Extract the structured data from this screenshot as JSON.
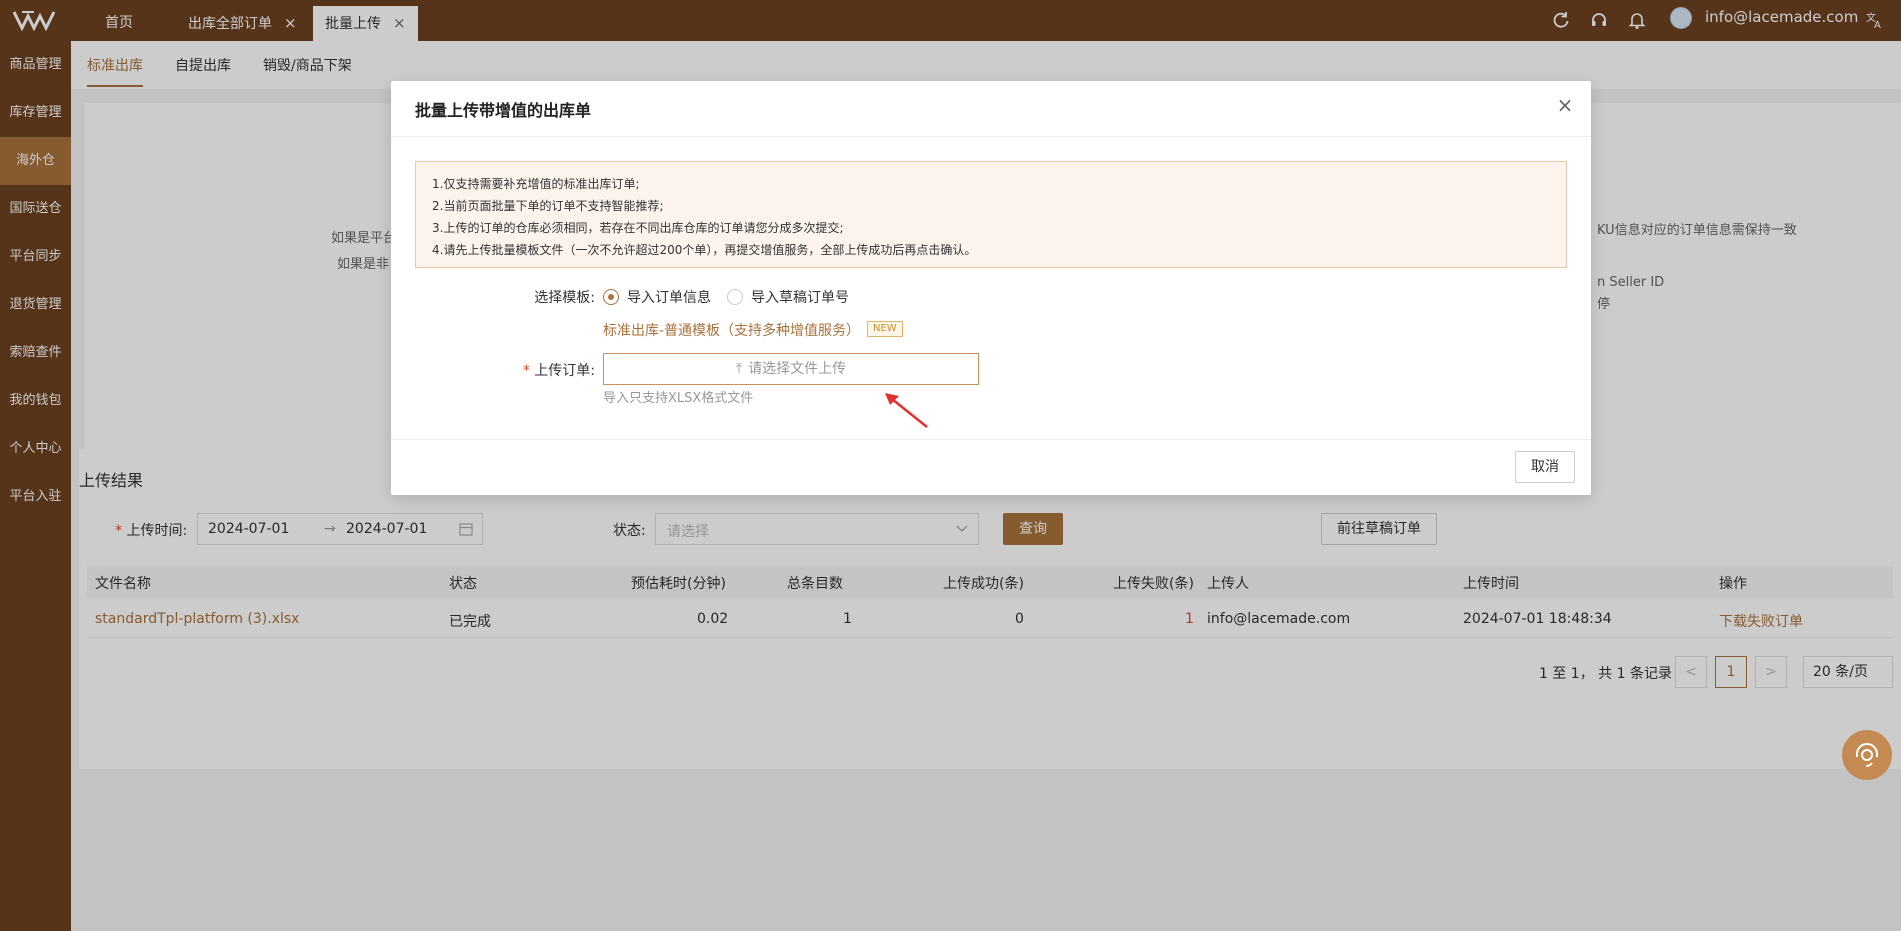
{
  "topbar": {
    "tabs": [
      {
        "label": "首页"
      },
      {
        "label": "出库全部订单"
      },
      {
        "label": "批量上传"
      }
    ],
    "user_email": "info@lacemade.com",
    "icons": [
      "refresh-icon",
      "headset-icon",
      "bell-icon",
      "translate-icon"
    ]
  },
  "sidebar": {
    "items": [
      {
        "label": "商品管理"
      },
      {
        "label": "库存管理"
      },
      {
        "label": "海外仓"
      },
      {
        "label": "国际送仓"
      },
      {
        "label": "平台同步"
      },
      {
        "label": "退货管理"
      },
      {
        "label": "索赔查件"
      },
      {
        "label": "我的钱包"
      },
      {
        "label": "个人中心"
      },
      {
        "label": "平台入驻"
      }
    ],
    "active_index": 2
  },
  "subtabs": [
    {
      "label": "标准出库"
    },
    {
      "label": "自提出库"
    },
    {
      "label": "销毁/商品下架"
    }
  ],
  "background_text": {
    "left1": "如果是平台",
    "left2": "如果是非",
    "right1": "KU信息对应的订单信息需保持一致",
    "right2": "n Seller ID",
    "right3": "停"
  },
  "upload_results": {
    "title": "上传结果",
    "time_label": "上传时间:",
    "date_start": "2024-07-01",
    "date_end": "2024-07-01",
    "status_label": "状态:",
    "status_placeholder": "请选择",
    "query_button": "查询",
    "draft_button": "前往草稿订单",
    "columns": [
      "文件名称",
      "状态",
      "预估耗时(分钟)",
      "总条目数",
      "上传成功(条)",
      "上传失败(条)",
      "上传人",
      "上传时间",
      "操作"
    ],
    "rows": [
      {
        "file_name": "standardTpl-platform (3).xlsx",
        "status": "已完成",
        "est_time": "0.02",
        "total": "1",
        "success": "0",
        "failed": "1",
        "uploader": "info@lacemade.com",
        "upload_time": "2024-07-01 18:48:34",
        "action": "下载失败订单"
      }
    ],
    "pagination": {
      "summary": "1 至 1， 共 1 条记录",
      "prev": "<",
      "current_page": "1",
      "next": ">",
      "page_size": "20 条/页"
    }
  },
  "modal": {
    "title": "批量上传带增值的出库单",
    "close": "×",
    "notice": [
      "1.仅支持需要补充增值的标准出库订单;",
      "2.当前页面批量下单的订单不支持智能推荐;",
      "3.上传的订单的仓库必须相同，若存在不同出库仓库的订单请您分成多次提交;",
      "4.请先上传批量模板文件（一次不允许超过200个单），再提交增值服务，全部上传成功后再点击确认。"
    ],
    "template_label": "选择模板:",
    "radio_options": [
      {
        "label": "导入订单信息",
        "checked": true
      },
      {
        "label": "导入草稿订单号",
        "checked": false
      }
    ],
    "template_link": "标准出库-普通模板（支持多种增值服务）",
    "template_badge": "NEW",
    "upload_label": "上传订单:",
    "required_mark": "*",
    "upload_placeholder": "请选择文件上传",
    "upload_hint": "导入只支持XLSX格式文件",
    "cancel_button": "取消"
  },
  "colors": {
    "brand_dark": "#6b4121",
    "accent": "#a8723c",
    "error": "#e3422e"
  }
}
